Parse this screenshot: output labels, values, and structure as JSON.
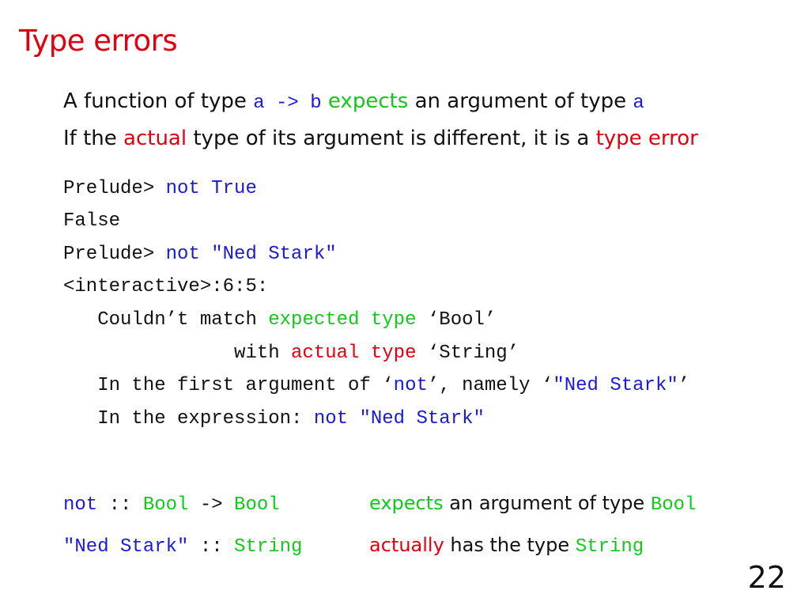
{
  "slide": {
    "title": "Type errors",
    "page_number": "22"
  },
  "intro": {
    "line1": {
      "t1": "A function of type ",
      "c1": "a -> b",
      "t2": " ",
      "g1": "expects",
      "t3": " an argument of type ",
      "c2": "a"
    },
    "line2": {
      "t1": "If the ",
      "r1": "actual",
      "t2": " type of its argument is different, it is a ",
      "r2": "type error"
    }
  },
  "session": {
    "l1": {
      "prompt": "Prelude> ",
      "input": "not True"
    },
    "l2": {
      "output": "False"
    },
    "l3": {
      "prompt": "Prelude> ",
      "input": "not \"Ned Stark\""
    },
    "l4": {
      "text": "<interactive>:6:5:"
    },
    "l5": {
      "t1": "   Couldn’t match ",
      "g1": "expected type",
      "t2": " ‘Bool’"
    },
    "l6": {
      "t1": "               with ",
      "r1": "actual type",
      "t2": " ‘String’"
    },
    "l7": {
      "t1": "   In the first argument of ‘",
      "b1": "not",
      "t2": "’, namely ‘",
      "b2": "\"Ned Stark\"",
      "t3": "’"
    },
    "l8": {
      "t1": "   In the expression: ",
      "b1": "not \"Ned Stark\""
    }
  },
  "summary": {
    "row1": {
      "fn": "not",
      "sep": " :: ",
      "type_a": "Bool",
      "arrow": " -> ",
      "type_b": "Bool",
      "g1": "expects",
      "t1": " an argument of type ",
      "type_c": "Bool"
    },
    "row2": {
      "val": "\"Ned Stark\"",
      "sep": " :: ",
      "type_a": "String",
      "r1": "actually",
      "t1": " has the type ",
      "type_b": "String"
    }
  }
}
